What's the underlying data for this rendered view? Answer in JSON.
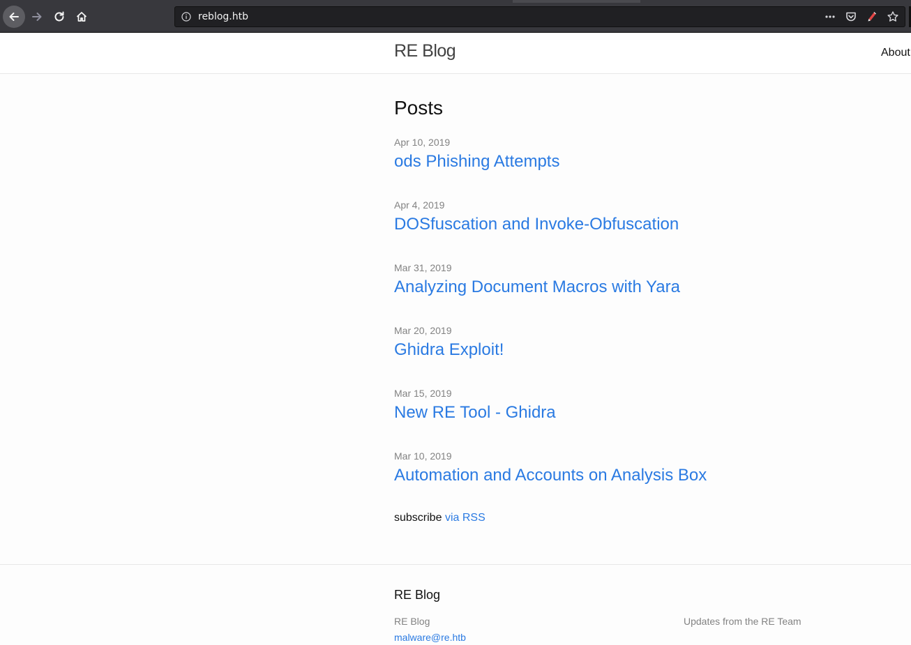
{
  "browser": {
    "url": "reblog.htb"
  },
  "header": {
    "site_title": "RE Blog",
    "nav_about": "About"
  },
  "main": {
    "heading": "Posts",
    "posts": [
      {
        "date": "Apr 10, 2019",
        "title": "ods Phishing Attempts"
      },
      {
        "date": "Apr 4, 2019",
        "title": "DOSfuscation and Invoke-Obfuscation"
      },
      {
        "date": "Mar 31, 2019",
        "title": "Analyzing Document Macros with Yara"
      },
      {
        "date": "Mar 20, 2019",
        "title": "Ghidra Exploit!"
      },
      {
        "date": "Mar 15, 2019",
        "title": "New RE Tool - Ghidra"
      },
      {
        "date": "Mar 10, 2019",
        "title": "Automation and Accounts on Analysis Box"
      }
    ],
    "subscribe_text": "subscribe",
    "subscribe_link": "via RSS"
  },
  "footer": {
    "title": "RE Blog",
    "name": "RE Blog",
    "email": "malware@re.htb",
    "description": "Updates from the RE Team"
  },
  "colors": {
    "link": "#2a7ae2",
    "muted": "#828282",
    "chrome_bg": "#38383d"
  }
}
